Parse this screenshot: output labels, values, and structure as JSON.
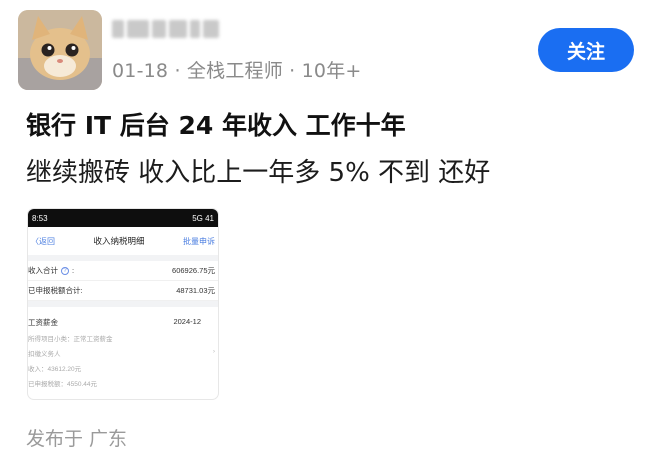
{
  "author": {
    "meta": "01-18 · 全栈工程师 · 10年+"
  },
  "follow_button": {
    "label": "关注"
  },
  "post": {
    "title": "银行 IT 后台 24 年收入 工作十年",
    "body": "继续搬砖 收入比上一年多 5% 不到 还好",
    "location": "发布于 广东"
  },
  "screenshot": {
    "time": "8:53",
    "status_right": "5G 41",
    "back_label": "〈返回",
    "title": "收入纳税明细",
    "action_label": "批量申诉",
    "rows": [
      {
        "label": "收入合计",
        "value": "606926.75元"
      },
      {
        "label": "已申报税额合计:",
        "value": "48731.03元"
      }
    ],
    "income_label": "收入合计",
    "income_value": "606926.75元",
    "tax_label": "已申报税额合计:",
    "tax_value": "48731.03元",
    "detail": {
      "name": "工资薪金",
      "period": "2024-12",
      "sub_item": "所得项目小类：正常工资薪金",
      "payer": "扣缴义务人",
      "income": "收入：43612.20元",
      "declared_tax": "已申报税额：4550.44元"
    }
  },
  "colors": {
    "accent": "#1a6ef2",
    "meta_gray": "#8a8a8a",
    "link_blue": "#4a7de0"
  }
}
